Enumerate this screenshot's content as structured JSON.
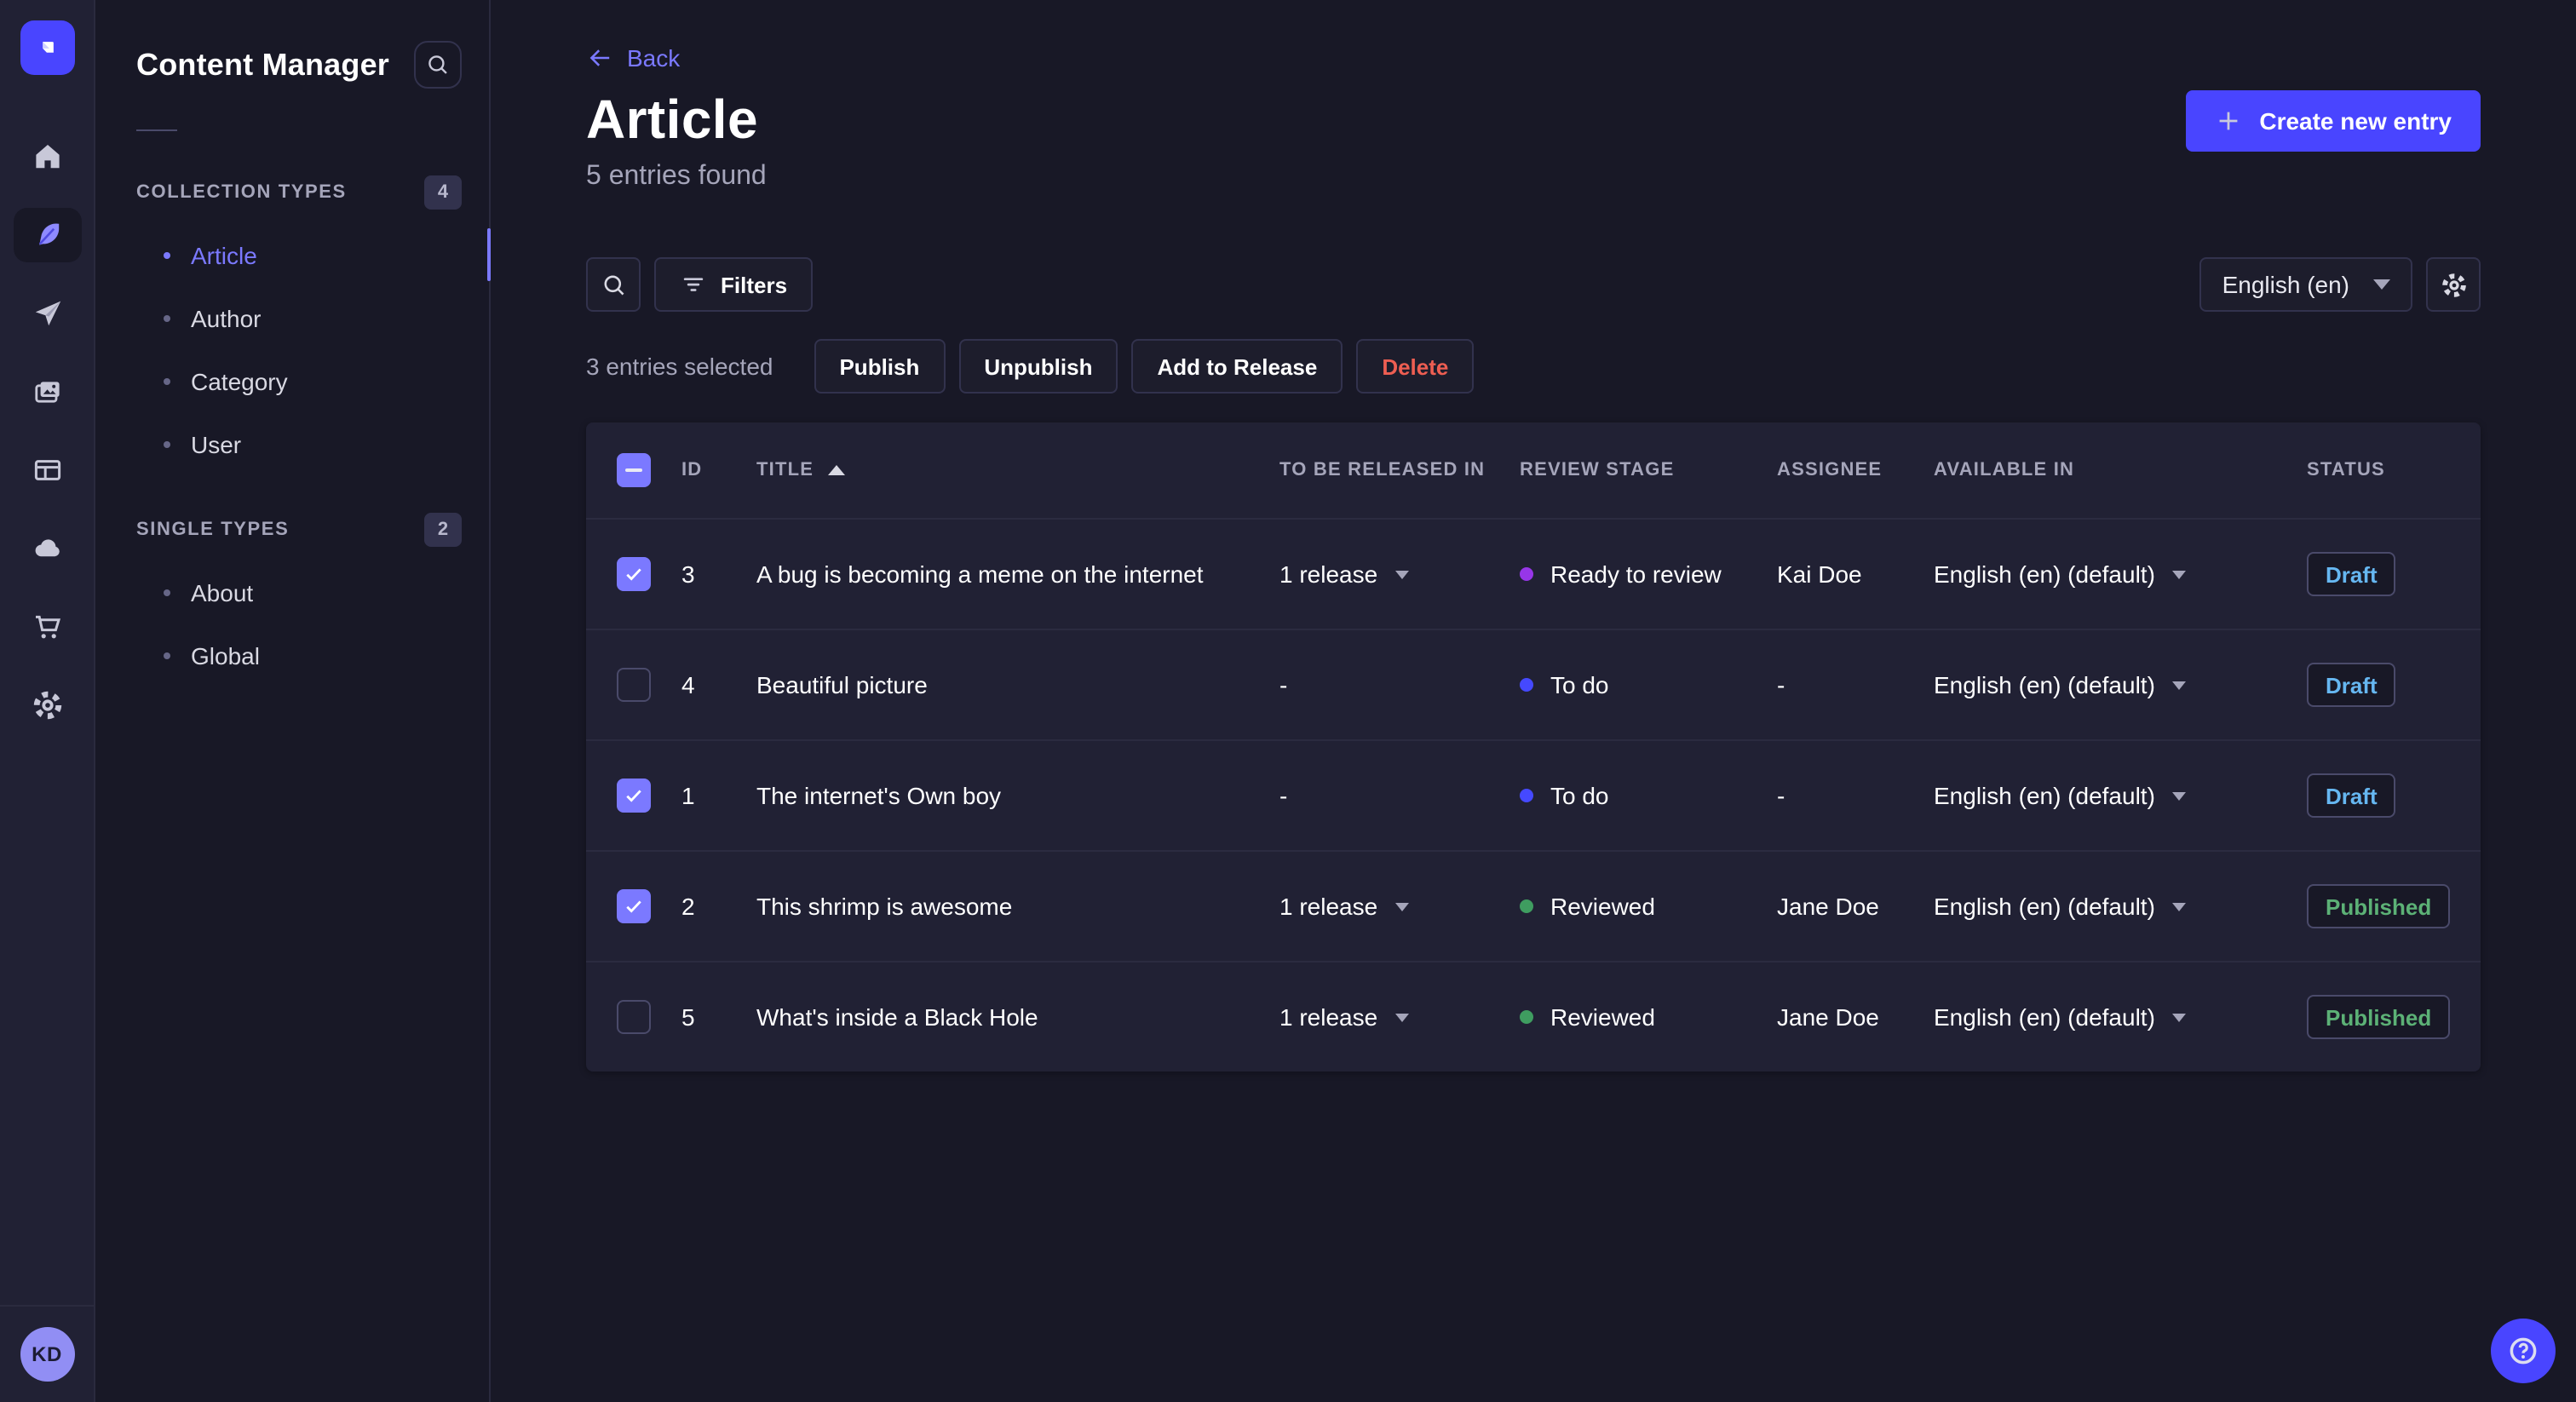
{
  "colors": {
    "accent": "#4945ff",
    "accent_light": "#7b79ff",
    "draft": "#66b7f1",
    "published": "#5cb176",
    "danger": "#ee5e52",
    "stage_todo": "#4549ff",
    "stage_ready": "#9736e8",
    "stage_reviewed": "#3f9d60"
  },
  "nav_rail": {
    "items": [
      {
        "icon": "home-icon",
        "active": false
      },
      {
        "icon": "content-manager-icon",
        "active": true
      },
      {
        "icon": "releases-icon",
        "active": false
      },
      {
        "icon": "media-library-icon",
        "active": false
      },
      {
        "icon": "content-type-builder-icon",
        "active": false
      },
      {
        "icon": "cloud-icon",
        "active": false
      },
      {
        "icon": "marketplace-icon",
        "active": false
      },
      {
        "icon": "settings-icon",
        "active": false
      }
    ],
    "avatar_initials": "KD"
  },
  "sidebar": {
    "title": "Content Manager",
    "sections": [
      {
        "label": "COLLECTION TYPES",
        "count": "4",
        "items": [
          {
            "label": "Article",
            "active": true
          },
          {
            "label": "Author",
            "active": false
          },
          {
            "label": "Category",
            "active": false
          },
          {
            "label": "User",
            "active": false
          }
        ]
      },
      {
        "label": "SINGLE TYPES",
        "count": "2",
        "items": [
          {
            "label": "About",
            "active": false
          },
          {
            "label": "Global",
            "active": false
          }
        ]
      }
    ]
  },
  "header": {
    "back_label": "Back",
    "title": "Article",
    "subtitle": "5 entries found",
    "create_button": "Create new entry"
  },
  "toolbar": {
    "filters_label": "Filters",
    "locale": "English (en)"
  },
  "selection": {
    "label": "3 entries selected",
    "publish": "Publish",
    "unpublish": "Unpublish",
    "add_to_release": "Add to Release",
    "delete": "Delete"
  },
  "table": {
    "columns": {
      "id": "ID",
      "title": "TITLE",
      "release": "TO BE RELEASED IN",
      "stage": "REVIEW STAGE",
      "assignee": "ASSIGNEE",
      "available": "AVAILABLE IN",
      "status": "STATUS"
    },
    "rows": [
      {
        "checked": true,
        "id": "3",
        "title": "A bug is becoming a meme on the internet",
        "release": "1 release",
        "release_dropdown": true,
        "stage": "Ready to review",
        "stage_color": "#9736e8",
        "assignee": "Kai Doe",
        "locale": "English (en) (default)",
        "status": "Draft",
        "status_color": "#66b7f1"
      },
      {
        "checked": false,
        "id": "4",
        "title": "Beautiful picture",
        "release": "-",
        "release_dropdown": false,
        "stage": "To do",
        "stage_color": "#4549ff",
        "assignee": "-",
        "locale": "English (en) (default)",
        "status": "Draft",
        "status_color": "#66b7f1"
      },
      {
        "checked": true,
        "id": "1",
        "title": "The internet's Own boy",
        "release": "-",
        "release_dropdown": false,
        "stage": "To do",
        "stage_color": "#4549ff",
        "assignee": "-",
        "locale": "English (en) (default)",
        "status": "Draft",
        "status_color": "#66b7f1"
      },
      {
        "checked": true,
        "id": "2",
        "title": "This shrimp is awesome",
        "release": "1 release",
        "release_dropdown": true,
        "stage": "Reviewed",
        "stage_color": "#3f9d60",
        "assignee": "Jane Doe",
        "locale": "English (en) (default)",
        "status": "Published",
        "status_color": "#5cb176"
      },
      {
        "checked": false,
        "id": "5",
        "title": "What's inside a Black Hole",
        "release": "1 release",
        "release_dropdown": true,
        "stage": "Reviewed",
        "stage_color": "#3f9d60",
        "assignee": "Jane Doe",
        "locale": "English (en) (default)",
        "status": "Published",
        "status_color": "#5cb176"
      }
    ]
  }
}
